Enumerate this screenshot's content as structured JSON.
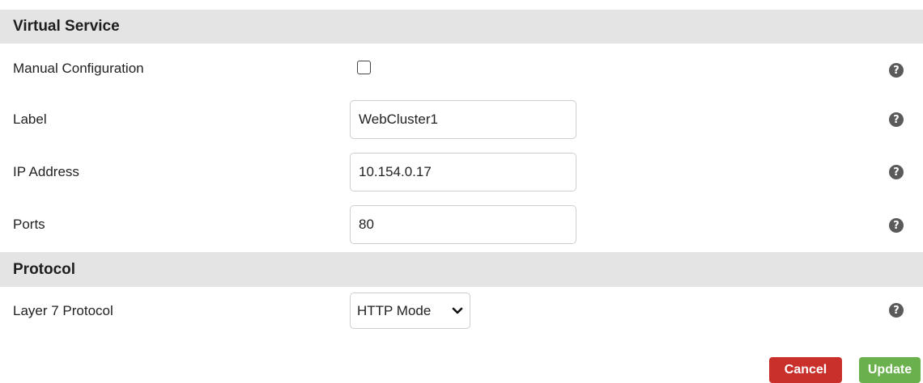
{
  "sections": {
    "virtual_service": {
      "title": "Virtual Service"
    },
    "protocol": {
      "title": "Protocol"
    }
  },
  "fields": {
    "manual_configuration": {
      "label": "Manual Configuration",
      "checked": false
    },
    "label": {
      "label": "Label",
      "value": "WebCluster1"
    },
    "ip_address": {
      "label": "IP Address",
      "value": "10.154.0.17"
    },
    "ports": {
      "label": "Ports",
      "value": "80"
    },
    "layer7_protocol": {
      "label": "Layer 7 Protocol",
      "value": "HTTP Mode"
    }
  },
  "help": {
    "glyph": "?"
  },
  "buttons": {
    "cancel": "Cancel",
    "update": "Update"
  },
  "colors": {
    "header_bg": "#e4e4e4",
    "cancel": "#c9302c",
    "update": "#6ab04c",
    "help_icon": "#5a5a5a"
  },
  "icons": {
    "help": "question-circle-icon",
    "select_arrow": "chevron-down-icon"
  }
}
